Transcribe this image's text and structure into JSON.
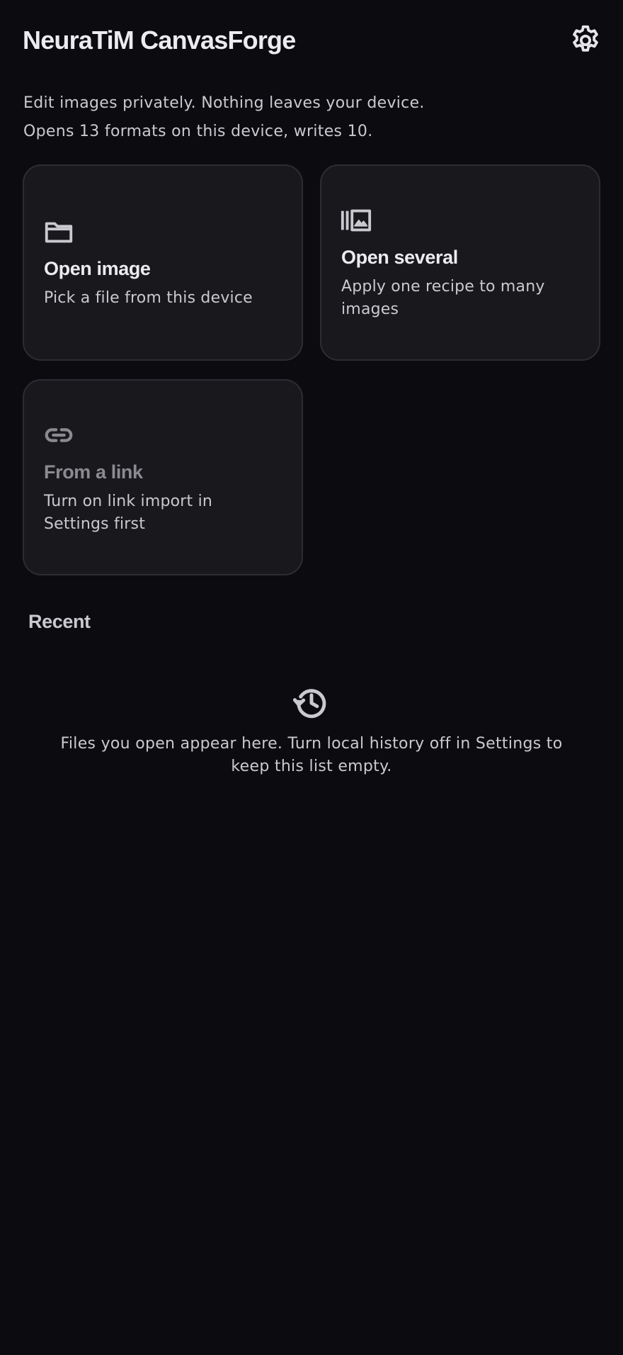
{
  "header": {
    "title": "NeuraTiM CanvasForge",
    "settings_icon": "gear-icon"
  },
  "intro": {
    "line1": "Edit images privately. Nothing leaves your device.",
    "line2": "Opens 13 formats on this device, writes 10."
  },
  "cards": [
    {
      "icon": "folder-icon",
      "title": "Open image",
      "subtitle": "Pick a file from this device",
      "enabled": true
    },
    {
      "icon": "image-stack-icon",
      "title": "Open several",
      "subtitle": "Apply one recipe to many images",
      "enabled": true
    },
    {
      "icon": "link-icon",
      "title": "From a link",
      "subtitle": "Turn on link import in Settings first",
      "enabled": false
    }
  ],
  "recent": {
    "heading": "Recent",
    "empty_icon": "history-icon",
    "empty_text": "Files you open appear here. Turn local history off in Settings to keep this list empty."
  },
  "colors": {
    "background": "#0c0c10",
    "card": "#19191d",
    "card_border": "#2c2c32",
    "text_primary": "#ececf0",
    "text_secondary": "#c9c9cf",
    "text_disabled": "#8a8a90"
  }
}
